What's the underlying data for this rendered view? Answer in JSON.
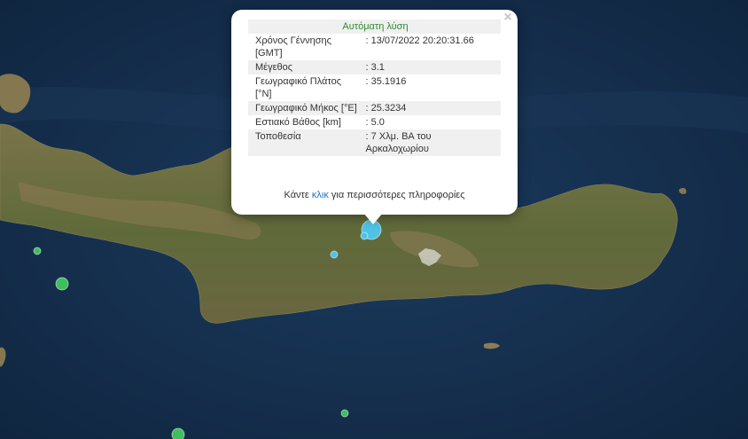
{
  "map": {
    "colors": {
      "sea": "#16304f",
      "land": "#6b6a40"
    },
    "markers": [
      {
        "name": "marker-main",
        "color": "#4fc3e6",
        "magnitude": 3.1
      },
      {
        "name": "marker-small-1",
        "color": "#4fc3e6"
      },
      {
        "name": "marker-small-2",
        "color": "#4fc3e6"
      },
      {
        "name": "marker-small-3",
        "color": "#3dbf5e"
      },
      {
        "name": "marker-small-4",
        "color": "#3dbf5e"
      },
      {
        "name": "marker-small-5",
        "color": "#3dbf5e"
      },
      {
        "name": "marker-small-6",
        "color": "#3dbf5e"
      }
    ]
  },
  "popup": {
    "title": "Αυτόματη λύση",
    "rows": [
      {
        "label": "Χρόνος Γέννησης [GMT]",
        "value": ": 13/07/2022 20:20:31.66"
      },
      {
        "label": "Μέγεθος",
        "value": ": 3.1"
      },
      {
        "label": "Γεωγραφικό Πλάτος [°N]",
        "value": ": 35.1916"
      },
      {
        "label": "Γεωγραφικό Μήκος [°E]",
        "value": ": 25.3234"
      },
      {
        "label": "Εστιακό Βάθος [km]",
        "value": ": 5.0"
      },
      {
        "label": "Τοποθεσία",
        "value": ": 7 Χλμ. ΒΑ του Αρκαλοχωρίου"
      }
    ],
    "more_prefix": "Κάντε",
    "more_link": "κλικ",
    "more_suffix": "για περισσότερες πληροφορίες",
    "close_label": "×"
  }
}
